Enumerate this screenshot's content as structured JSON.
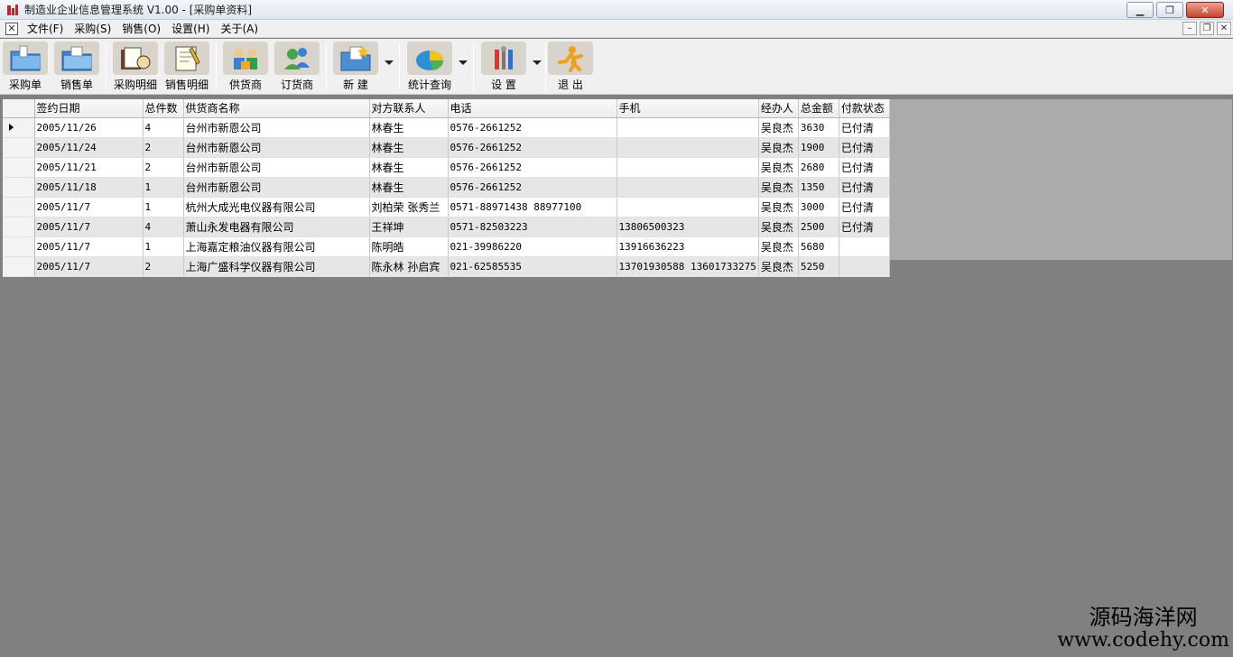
{
  "window": {
    "title": "制造业企业信息管理系统 V1.00 - [采购单资料]",
    "controls": [
      "minimize",
      "restore",
      "close"
    ]
  },
  "menubar": {
    "items": [
      "文件(F)",
      "采购(S)",
      "销售(O)",
      "设置(H)",
      "关于(A)"
    ]
  },
  "toolbar": {
    "buttons": [
      {
        "label": "采购单",
        "icon": "purchase-folder-icon"
      },
      {
        "label": "销售单",
        "icon": "sales-folder-icon"
      },
      {
        "label": "采购明细",
        "icon": "purchase-detail-icon"
      },
      {
        "label": "销售明细",
        "icon": "sales-detail-icon"
      },
      {
        "label": "供货商",
        "icon": "supplier-icon"
      },
      {
        "label": "订货商",
        "icon": "customer-icon"
      },
      {
        "label": "新 建",
        "icon": "new-icon"
      },
      {
        "label": "统计查询",
        "icon": "statistics-icon"
      },
      {
        "label": "设 置",
        "icon": "settings-icon"
      },
      {
        "label": "退 出",
        "icon": "exit-icon"
      }
    ]
  },
  "grid": {
    "columns": [
      "签约日期",
      "总件数",
      "供货商名称",
      "对方联系人",
      "电话",
      "手机",
      "经办人",
      "总金额",
      "付款状态"
    ],
    "rows": [
      [
        "2005/11/26",
        "4",
        "台州市新恩公司",
        "林春生",
        "0576-2661252",
        "",
        "吴良杰",
        "3630",
        "已付清"
      ],
      [
        "2005/11/24",
        "2",
        "台州市新恩公司",
        "林春生",
        "0576-2661252",
        "",
        "吴良杰",
        "1900",
        "已付清"
      ],
      [
        "2005/11/21",
        "2",
        "台州市新恩公司",
        "林春生",
        "0576-2661252",
        "",
        "吴良杰",
        "2680",
        "已付清"
      ],
      [
        "2005/11/18",
        "1",
        "台州市新恩公司",
        "林春生",
        "0576-2661252",
        "",
        "吴良杰",
        "1350",
        "已付清"
      ],
      [
        "2005/11/7",
        "1",
        "杭州大成光电仪器有限公司",
        "刘柏荣 张秀兰",
        "0571-88971438 88977100",
        "",
        "吴良杰",
        "3000",
        "已付清"
      ],
      [
        "2005/11/7",
        "4",
        "萧山永发电器有限公司",
        "王祥坤",
        "0571-82503223",
        "13806500323",
        "吴良杰",
        "2500",
        "已付清"
      ],
      [
        "2005/11/7",
        "1",
        "上海嘉定粮油仪器有限公司",
        "陈明皓",
        "021-39986220",
        "13916636223",
        "吴良杰",
        "5680",
        ""
      ],
      [
        "2005/11/7",
        "2",
        "上海广盛科学仪器有限公司",
        "陈永林 孙启宾",
        "021-62585535",
        "13701930588 13601733275",
        "吴良杰",
        "5250",
        ""
      ]
    ]
  },
  "watermark": {
    "cn": "源码海洋网",
    "en": "www.codehy.com"
  }
}
